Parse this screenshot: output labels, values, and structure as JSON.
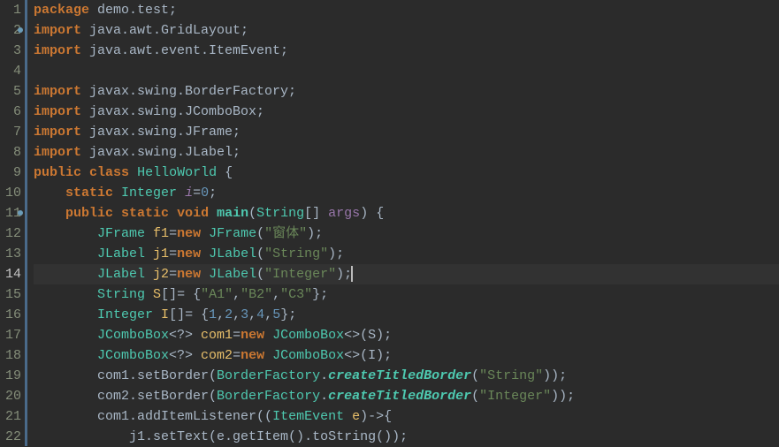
{
  "lines": {
    "l1": {
      "num": "1",
      "kw1": "package",
      "txt1": " demo.test;"
    },
    "l2": {
      "num": "2",
      "kw1": "import",
      "txt1": " java.awt.GridLayout;",
      "marker": true
    },
    "l3": {
      "num": "3",
      "kw1": "import",
      "txt1": " java.awt.event.ItemEvent;"
    },
    "l4": {
      "num": "4"
    },
    "l5": {
      "num": "5",
      "kw1": "import",
      "txt1": " javax.swing.BorderFactory;"
    },
    "l6": {
      "num": "6",
      "kw1": "import",
      "txt1": " javax.swing.JComboBox;"
    },
    "l7": {
      "num": "7",
      "kw1": "import",
      "txt1": " javax.swing.JFrame;"
    },
    "l8": {
      "num": "8",
      "kw1": "import",
      "txt1": " javax.swing.JLabel;"
    },
    "l9": {
      "num": "9",
      "kw1": "public",
      "kw2": "class",
      "type1": "HelloWorld",
      "txt1": " {"
    },
    "l10": {
      "num": "10",
      "pad": "    ",
      "kw1": "static",
      "type1": "Integer",
      "var1": "i",
      "txt1": "=",
      "num1": "0",
      "txt2": ";"
    },
    "l11": {
      "num": "11",
      "pad": "    ",
      "kw1": "public",
      "kw2": "static",
      "kw3": "void",
      "method1": "main",
      "txt1": "(",
      "type1": "String",
      "txt2": "[] ",
      "var1": "args",
      "txt3": ") {",
      "marker": true
    },
    "l12": {
      "num": "12",
      "pad": "        ",
      "type1": "JFrame",
      "ident1": "f1",
      "txt1": "=",
      "kw1": "new",
      "type2": "JFrame",
      "txt2": "(",
      "str1": "\"窗体\"",
      "txt3": ");"
    },
    "l13": {
      "num": "13",
      "pad": "        ",
      "type1": "JLabel",
      "ident1": "j1",
      "txt1": "=",
      "kw1": "new",
      "type2": "JLabel",
      "txt2": "(",
      "str1": "\"String\"",
      "txt3": ");"
    },
    "l14": {
      "num": "14",
      "pad": "        ",
      "type1": "JLabel",
      "ident1": "j2",
      "txt1": "=",
      "kw1": "new",
      "type2": "JLabel",
      "txt2": "(",
      "str1": "\"Integer\"",
      "txt3": ");",
      "current": true
    },
    "l15": {
      "num": "15",
      "pad": "        ",
      "type1": "String",
      "ident1": "S",
      "txt1": "[]= {",
      "str1": "\"A1\"",
      "txt2": ",",
      "str2": "\"B2\"",
      "txt3": ",",
      "str3": "\"C3\"",
      "txt4": "};"
    },
    "l16": {
      "num": "16",
      "pad": "        ",
      "type1": "Integer",
      "ident1": "I",
      "txt1": "[]= {",
      "num1": "1",
      "c1": ",",
      "num2": "2",
      "c2": ",",
      "num3": "3",
      "c3": ",",
      "num4": "4",
      "c4": ",",
      "num5": "5",
      "txt2": "};"
    },
    "l17": {
      "num": "17",
      "pad": "        ",
      "type1": "JComboBox",
      "txt1": "<?> ",
      "ident1": "com1",
      "txt2": "=",
      "kw1": "new",
      "type2": "JComboBox",
      "txt3": "<>(S);"
    },
    "l18": {
      "num": "18",
      "pad": "        ",
      "type1": "JComboBox",
      "txt1": "<?> ",
      "ident1": "com2",
      "txt2": "=",
      "kw1": "new",
      "type2": "JComboBox",
      "txt3": "<>(I);"
    },
    "l19": {
      "num": "19",
      "pad": "        ",
      "txt1": "com1.setBorder(",
      "type1": "BorderFactory",
      "txt2": ".",
      "method1": "createTitledBorder",
      "txt3": "(",
      "str1": "\"String\"",
      "txt4": "));"
    },
    "l20": {
      "num": "20",
      "pad": "        ",
      "txt1": "com2.setBorder(",
      "type1": "BorderFactory",
      "txt2": ".",
      "method1": "createTitledBorder",
      "txt3": "(",
      "str1": "\"Integer\"",
      "txt4": "));"
    },
    "l21": {
      "num": "21",
      "pad": "        ",
      "txt1": "com1.addItemListener((",
      "type1": "ItemEvent",
      "ident1": "e",
      "txt2": ")->{"
    },
    "l22": {
      "num": "22",
      "pad": "            ",
      "txt1": "j1.setText(e.getItem().toString());"
    }
  }
}
